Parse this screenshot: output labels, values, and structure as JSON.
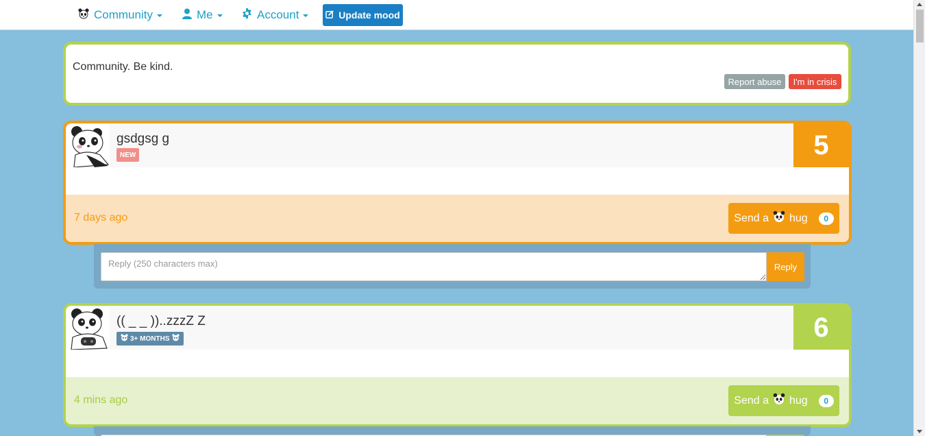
{
  "nav": {
    "community_label": "Community",
    "me_label": "Me",
    "account_label": "Account",
    "update_mood_label": "Update mood"
  },
  "community": {
    "text": "Community. Be kind.",
    "report_label": "Report abuse",
    "crisis_label": "I'm in crisis"
  },
  "posts": [
    {
      "title": "gsdgsg g",
      "badge": "NEW",
      "score": "5",
      "time": "7 days ago",
      "hug_prefix": "Send a",
      "hug_suffix": "hug",
      "hug_count": "0",
      "accent": "#f39c12"
    },
    {
      "title": "(( _ _ ))..zzzZ Z",
      "badge": "3+ MONTHS",
      "score": "6",
      "time": "4 mins ago",
      "hug_prefix": "Send a",
      "hug_suffix": "hug",
      "hug_count": "0",
      "accent": "#b1d34e"
    }
  ],
  "reply": {
    "placeholder": "Reply (250 characters max)",
    "button_label": "Reply"
  },
  "colors": {
    "background": "#86bedd",
    "link": "#1da1c8",
    "update_button": "#1a7fc4",
    "orange": "#f39c12",
    "green": "#b1d34e",
    "crisis": "#e74c3c",
    "report": "#95a5a6"
  }
}
